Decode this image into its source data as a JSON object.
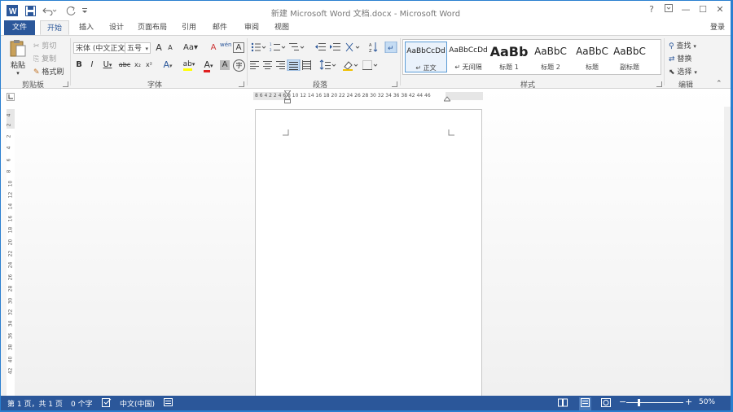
{
  "window": {
    "title": "新建 Microsoft Word 文档.docx - Microsoft Word",
    "login": "登录"
  },
  "quick_access": {
    "app_icon": "word-icon",
    "save_icon": "save-icon",
    "undo_icon": "undo-icon",
    "redo_icon": "redo-icon",
    "customize_icon": "customize-icon"
  },
  "window_controls": {
    "help": "?",
    "ribbon_display": "ribbon-display-icon",
    "minimize": "—",
    "restore": "☐",
    "close": "✕"
  },
  "tabs": [
    {
      "label": "文件"
    },
    {
      "label": "开始"
    },
    {
      "label": "插入"
    },
    {
      "label": "设计"
    },
    {
      "label": "页面布局"
    },
    {
      "label": "引用"
    },
    {
      "label": "邮件"
    },
    {
      "label": "审阅"
    },
    {
      "label": "视图"
    }
  ],
  "clipboard": {
    "group_label": "剪贴板",
    "paste": "粘贴",
    "cut": "剪切",
    "copy": "复制",
    "format_painter": "格式刷"
  },
  "font": {
    "group_label": "字体",
    "font_name": "宋体 (中文正文)",
    "font_size": "五号",
    "grow_font": "A",
    "shrink_font": "A",
    "change_case": "Aa",
    "clear_format": "A",
    "phonetic": "wén",
    "char_border": "A",
    "bold": "B",
    "italic": "I",
    "underline": "U",
    "strikethrough": "abc",
    "subscript": "x₂",
    "superscript": "x²",
    "text_effect": "A",
    "highlight": "ab",
    "font_color": "A",
    "char_shading": "A",
    "enclose_char": "字"
  },
  "paragraph": {
    "group_label": "段落"
  },
  "styles": {
    "group_label": "样式",
    "items": [
      {
        "sample": "AaBbCcDd",
        "name": "↵ 正文"
      },
      {
        "sample": "AaBbCcDd",
        "name": "↵ 无间隔"
      },
      {
        "sample": "AaBb",
        "name": "标题 1"
      },
      {
        "sample": "AaBbC",
        "name": "标题 2"
      },
      {
        "sample": "AaBbC",
        "name": "标题"
      },
      {
        "sample": "AaBbC",
        "name": "副标题"
      }
    ]
  },
  "editing": {
    "group_label": "编辑",
    "find": "查找",
    "replace": "替换",
    "select": "选择"
  },
  "ruler": {
    "h_numbers": "8  6  4  2     2   4   6   8  10 12 14 16 18 20 22 24 26 28 30 32 34 36 38     42 44 46",
    "v_numbers": [
      "4",
      "2",
      "2",
      "4",
      "6",
      "8",
      "10",
      "12",
      "14",
      "16",
      "18",
      "20",
      "22",
      "24",
      "26",
      "28",
      "30",
      "32",
      "34",
      "36",
      "38",
      "40",
      "42"
    ]
  },
  "statusbar": {
    "page": "第 1 页，共 1 页",
    "words": "0 个字",
    "language": "中文(中国)",
    "zoom": "50%"
  },
  "colors": {
    "accent": "#2b579a",
    "ribbon_bg": "#f3f3f3",
    "desktop": "#2a7fd0"
  }
}
